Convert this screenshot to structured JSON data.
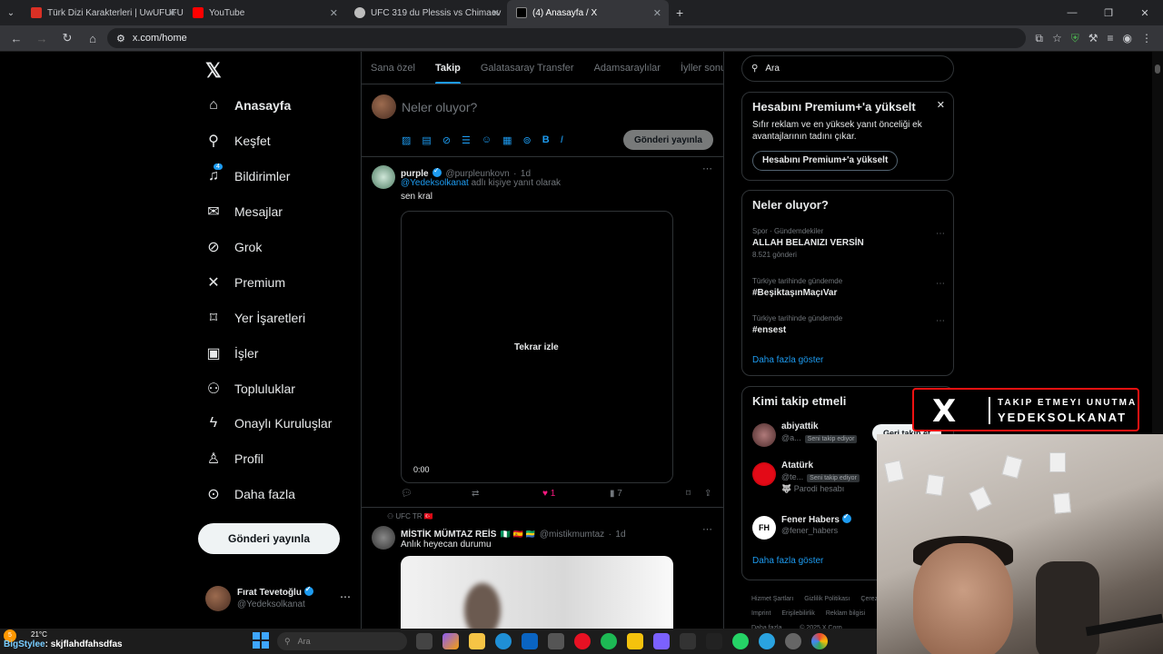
{
  "browser": {
    "tabs": [
      {
        "label": "Türk Dizi Karakterleri | UwUFUFU",
        "color": "#d93025"
      },
      {
        "label": "YouTube",
        "color": "#ff0000"
      },
      {
        "label": "UFC 319 du Plessis vs Chimaev",
        "color": "#bdbdbd"
      },
      {
        "label": "(4) Anasayfa / X",
        "color": "#000000"
      }
    ],
    "url": "x.com/home"
  },
  "sidebar": {
    "items": [
      {
        "label": "Anasayfa",
        "icon": "home-icon",
        "glyph": "⌂"
      },
      {
        "label": "Keşfet",
        "icon": "search-icon",
        "glyph": "⚲"
      },
      {
        "label": "Bildirimler",
        "icon": "bell-icon",
        "glyph": "🔔",
        "badge": "4"
      },
      {
        "label": "Mesajlar",
        "icon": "mail-icon",
        "glyph": "✉"
      },
      {
        "label": "Grok",
        "icon": "grok-icon",
        "glyph": "⊘"
      },
      {
        "label": "Premium",
        "icon": "x-icon",
        "glyph": "𝕏"
      },
      {
        "label": "Yer İşaretleri",
        "icon": "bookmark-icon",
        "glyph": "🔖"
      },
      {
        "label": "İşler",
        "icon": "briefcase-icon",
        "glyph": "💼"
      },
      {
        "label": "Topluluklar",
        "icon": "people-icon",
        "glyph": "👥"
      },
      {
        "label": "Onaylı Kuruluşlar",
        "icon": "lightning-icon",
        "glyph": "ϟ"
      },
      {
        "label": "Profil",
        "icon": "person-icon",
        "glyph": "👤"
      },
      {
        "label": "Daha fazla",
        "icon": "more-icon",
        "glyph": "⋯"
      }
    ],
    "post_button": "Gönderi yayınla",
    "account": {
      "name": "Fırat Tevetoğlu",
      "handle": "@Yedeksolkanat"
    }
  },
  "main": {
    "tabs": [
      "Sana özel",
      "Takip",
      "Galatasaray Transfer",
      "Adamsaraylılar",
      "İyller sonundaa"
    ],
    "compose_placeholder": "Neler oluyor?",
    "compose_post": "Gönderi yayınla",
    "tweets": [
      {
        "name": "purple",
        "handle": "@purpleunkovn",
        "time": "1d",
        "reply_to": "@Yedeksolkanat",
        "reply_text": "adlı kişiye yanıt olarak",
        "text": "sen kral",
        "replay": "Tekrar izle",
        "video_time": "0:00",
        "likes": "1",
        "views": "7"
      },
      {
        "community": "UFC TR 🇹🇷",
        "name": "MİSTİK MÜMTAZ REİS",
        "flags": "🇳🇬 🇪🇸 🇬🇦",
        "handle": "@mistikmumtaz",
        "time": "1d",
        "text": "Anlık heyecan durumu"
      }
    ]
  },
  "right": {
    "search_placeholder": "Ara",
    "premium": {
      "title": "Hesabını Premium+'a yükselt",
      "body": "Sıfır reklam ve en yüksek yanıt önceliği ek avantajlarının tadını çıkar.",
      "button": "Hesabını Premium+'a yükselt"
    },
    "trends_title": "Neler oluyor?",
    "trends": [
      {
        "category": "Spor · Gündemdekiler",
        "title": "ALLAH BELANIZI VERSİN",
        "posts": "8.521 gönderi"
      },
      {
        "category": "Türkiye tarihinde gündemde",
        "title": "#BeşiktaşınMaçıVar",
        "posts": ""
      },
      {
        "category": "Türkiye tarihinde gündemde",
        "title": "#ensest",
        "posts": ""
      }
    ],
    "show_more": "Daha fazla göster",
    "who_title": "Kimi takip etmeli",
    "who": [
      {
        "name": "abiyattik",
        "handle": "@a...",
        "follows_you": "Seni takip ediyor",
        "button": "Geri takip et",
        "sub": ""
      },
      {
        "name": "Atatürk",
        "handle": "@te...",
        "follows_you": "Seni takip ediyor",
        "button": "",
        "sub": "🐺 Parodi hesabı"
      },
      {
        "name": "Fener Habers",
        "handle": "@fener_habers",
        "follows_you": "",
        "button": "",
        "sub": ""
      }
    ],
    "footer": [
      "Hizmet Şartları",
      "Gizlilik Politikası",
      "Çerez",
      "Imprint",
      "Erişilebilirlik",
      "Reklam bilgisi",
      "Daha fazla ...",
      "© 2025 X Corp."
    ]
  },
  "overlay": {
    "line1": "TAKIP ETMEYI UNUTMA",
    "line2": "YEDEKSOLKANAT"
  },
  "taskbar": {
    "temperature": "21°C",
    "badge": "5",
    "search": "Ara",
    "chat_user": "BigStylee",
    "chat_text": "skjflahdfahsdfas"
  }
}
